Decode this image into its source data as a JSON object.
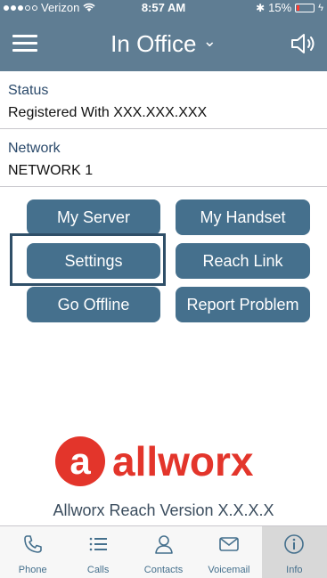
{
  "status_bar": {
    "carrier": "Verizon",
    "time": "8:57 AM",
    "battery": "15%",
    "battery_level": 0.15
  },
  "nav": {
    "title": "In Office",
    "title_chevron": "⌄",
    "menu_icon": "hamburger-icon",
    "speaker_icon": "speaker-icon"
  },
  "info": {
    "status_label": "Status",
    "status_value": "Registered With  XXX.XXX.XXX",
    "network_label": "Network",
    "network_value": "NETWORK 1"
  },
  "buttons": {
    "my_server": "My Server",
    "my_handset": "My Handset",
    "settings": "Settings",
    "reach_link": "Reach Link",
    "go_offline": "Go Offline",
    "report_problem": "Report Problem"
  },
  "branding": {
    "logo_text": "allworx",
    "version": "Allworx Reach Version X.X.X.X"
  },
  "tabs": [
    {
      "label": "Phone",
      "icon": "phone-icon",
      "active": false
    },
    {
      "label": "Calls",
      "icon": "list-icon",
      "active": false
    },
    {
      "label": "Contacts",
      "icon": "person-icon",
      "active": false
    },
    {
      "label": "Voicemail",
      "icon": "envelope-icon",
      "active": false
    },
    {
      "label": "Info",
      "icon": "info-icon",
      "active": true
    }
  ],
  "colors": {
    "header": "#5f7d93",
    "button": "#45708d",
    "brand_red": "#e3352b"
  }
}
